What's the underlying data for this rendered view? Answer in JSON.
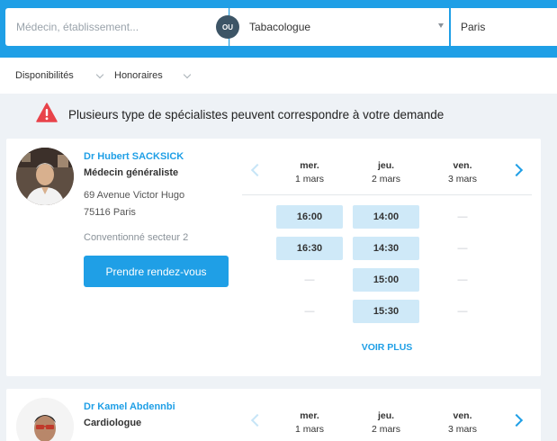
{
  "search": {
    "placeholder": "Médecin, établissement...",
    "separator": "OU",
    "specialty": "Tabacologue",
    "location": "Paris"
  },
  "filters": [
    {
      "label": "Disponibilités"
    },
    {
      "label": "Honoraires"
    }
  ],
  "warning": {
    "text": "Plusieurs type de spécialistes peuvent correspondre à votre demande",
    "icon": "warning-triangle-icon",
    "color": "#e8434a"
  },
  "colors": {
    "primary": "#1f9fe6",
    "slot": "#cfe9f8",
    "searchbar_bg": "#1f9fe6"
  },
  "doctors": [
    {
      "name": "Dr Hubert SACKSICK",
      "specialty": "Médecin généraliste",
      "address_line1": "69 Avenue Victor Hugo",
      "address_line2": "75116 Paris",
      "convention": "Conventionné secteur 2",
      "button": "Prendre rendez-vous",
      "days": [
        {
          "name": "mer.",
          "date": "1 mars"
        },
        {
          "name": "jeu.",
          "date": "2 mars"
        },
        {
          "name": "ven.",
          "date": "3 mars"
        }
      ],
      "slots": [
        [
          "16:00",
          "16:30",
          "—",
          "—"
        ],
        [
          "14:00",
          "14:30",
          "15:00",
          "15:30"
        ],
        [
          "—",
          "—",
          "—",
          "—"
        ]
      ],
      "more": "VOIR PLUS"
    },
    {
      "name": "Dr Kamel Abdennbi",
      "specialty": "Cardiologue",
      "days": [
        {
          "name": "mer.",
          "date": "1 mars"
        },
        {
          "name": "jeu.",
          "date": "2 mars"
        },
        {
          "name": "ven.",
          "date": "3 mars"
        }
      ]
    }
  ]
}
